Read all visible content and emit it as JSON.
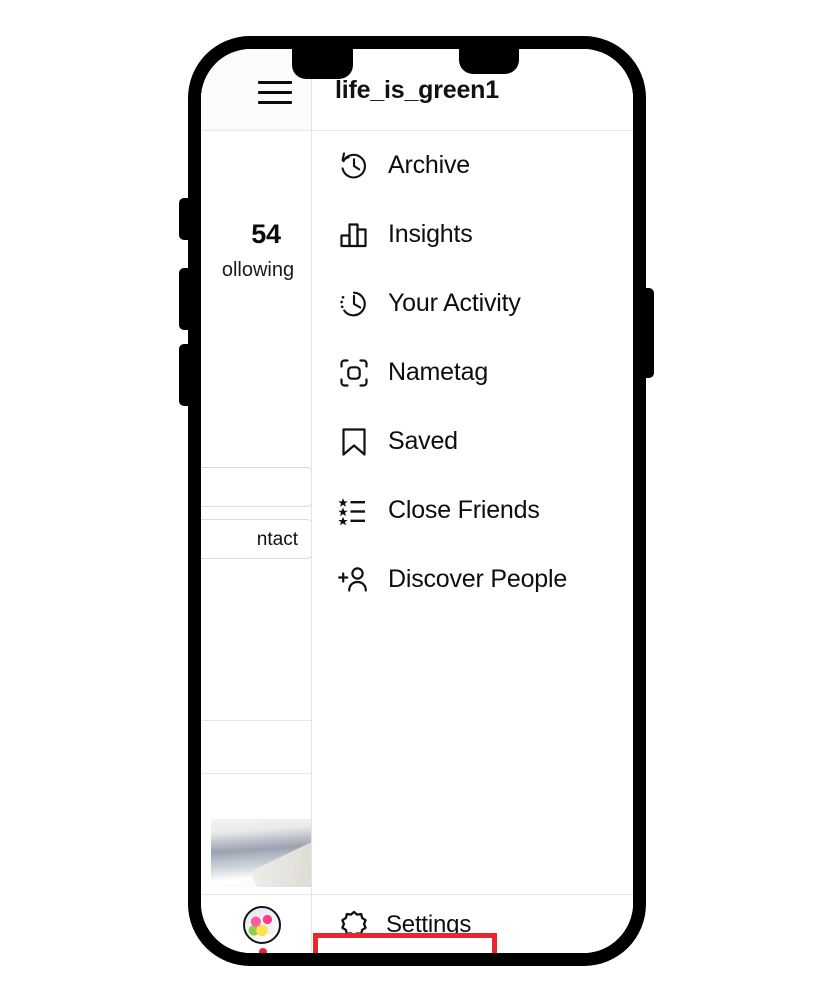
{
  "device": {
    "name": "smartphone-mockup",
    "frame_color": "#000000",
    "screen_background": "#ffffff"
  },
  "app": {
    "name": "Instagram profile menu"
  },
  "header": {
    "menu_icon": "hamburger-icon",
    "username": "life_is_green1"
  },
  "profile_background": {
    "stat_count": "54",
    "stat_label": "ollowing",
    "contact_button_label": "ntact",
    "edit_button_label": ""
  },
  "menu": {
    "items": [
      {
        "label": "Archive",
        "icon": "archive-clock-icon"
      },
      {
        "label": "Insights",
        "icon": "bar-chart-icon"
      },
      {
        "label": "Your Activity",
        "icon": "activity-clock-icon"
      },
      {
        "label": "Nametag",
        "icon": "nametag-scan-icon"
      },
      {
        "label": "Saved",
        "icon": "bookmark-icon"
      },
      {
        "label": "Close Friends",
        "icon": "star-list-icon"
      },
      {
        "label": "Discover People",
        "icon": "person-add-icon"
      }
    ],
    "settings": {
      "label": "Settings",
      "icon": "gear-icon",
      "highlighted": true,
      "highlight_color": "#e8262d"
    }
  }
}
